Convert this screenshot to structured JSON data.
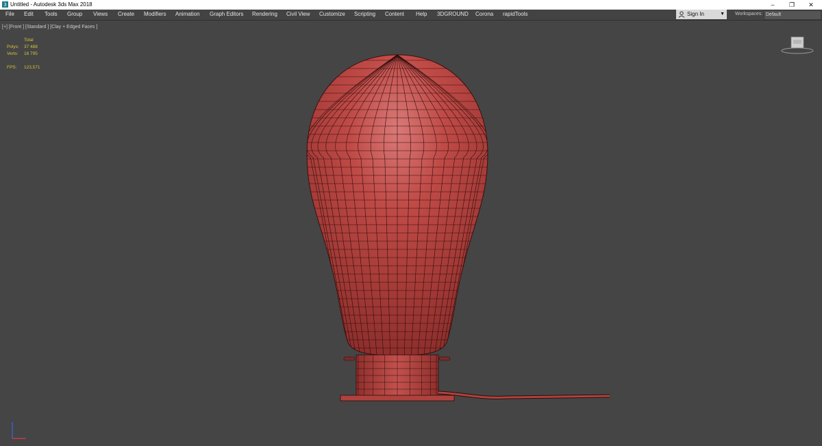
{
  "window": {
    "title": "Untitled - Autodesk 3ds Max 2018",
    "minimize": "–",
    "restore": "❐",
    "close": "✕"
  },
  "menu": [
    {
      "key": "file",
      "label": "File"
    },
    {
      "key": "edit",
      "label": "Edit"
    },
    {
      "key": "tools",
      "label": "Tools"
    },
    {
      "key": "group",
      "label": "Group"
    },
    {
      "key": "views",
      "label": "Views"
    },
    {
      "key": "create",
      "label": "Create"
    },
    {
      "key": "modifiers",
      "label": "Modifiers"
    },
    {
      "key": "animation",
      "label": "Animation"
    },
    {
      "key": "graph-editors",
      "label": "Graph Editors"
    },
    {
      "key": "rendering",
      "label": "Rendering"
    },
    {
      "key": "civil-view",
      "label": "Civil View"
    },
    {
      "key": "customize",
      "label": "Customize"
    },
    {
      "key": "scripting",
      "label": "Scripting"
    },
    {
      "key": "content",
      "label": "Content"
    },
    {
      "key": "help",
      "label": "Help"
    },
    {
      "key": "3dground",
      "label": "3DGROUND"
    },
    {
      "key": "corona",
      "label": "Corona"
    },
    {
      "key": "rapidtools",
      "label": "rapidTools"
    }
  ],
  "signin": {
    "label": "Sign In",
    "icon": "user-icon",
    "caret": "▼"
  },
  "workspaces": {
    "label": "Workspaces:",
    "value": "Default"
  },
  "viewport": {
    "label": "[+] [Front ] [Standard ] [Clay + Edged Faces ]",
    "stats": {
      "total_header": "Total",
      "polys_label": "Polys:",
      "polys_value": "37 488",
      "verts_label": "Verts:",
      "verts_value": "18 795",
      "fps_label": "FPS:",
      "fps_value": "123,571"
    }
  },
  "colors": {
    "viewport_bg": "#454545",
    "model_red": "#b5423f",
    "wire": "#2a0d0c",
    "stats_yellow": "#d6c23a"
  }
}
